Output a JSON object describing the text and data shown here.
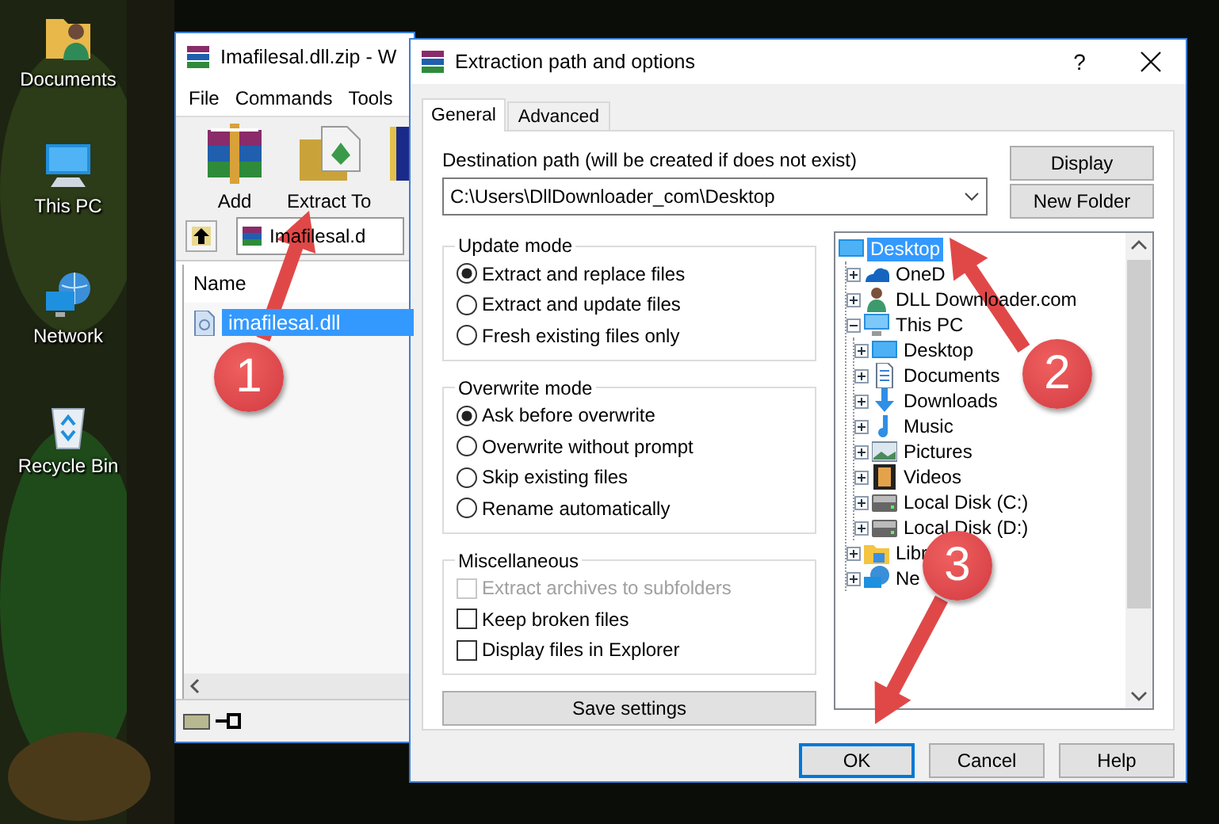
{
  "desktop": {
    "icons": [
      {
        "label": "Documents",
        "kind": "user-folder"
      },
      {
        "label": "This PC",
        "kind": "pc"
      },
      {
        "label": "Network",
        "kind": "network"
      },
      {
        "label": "Recycle Bin",
        "kind": "recycle"
      }
    ]
  },
  "archiver": {
    "title": "Imafilesal.dll.zip - W",
    "menu": [
      "File",
      "Commands",
      "Tools"
    ],
    "toolbar": [
      {
        "label": "Add",
        "kind": "add"
      },
      {
        "label": "Extract To",
        "kind": "extract"
      },
      {
        "kind": "book"
      }
    ],
    "address": "Imafilesal.d",
    "columns": [
      "Name"
    ],
    "files": [
      {
        "name": "imafilesal.dll",
        "selected": true
      }
    ]
  },
  "dialog": {
    "title": "Extraction path and options",
    "help": "?",
    "tabs": [
      {
        "label": "General",
        "selected": true
      },
      {
        "label": "Advanced",
        "selected": false
      }
    ],
    "destination": {
      "label": "Destination path (will be created if does not exist)",
      "value": "C:\\Users\\DllDownloader_com\\Desktop"
    },
    "side_buttons": [
      "Display",
      "New Folder"
    ],
    "groups": [
      {
        "title": "Update mode",
        "options": [
          {
            "kind": "radio",
            "label": "Extract and replace files",
            "selected": true
          },
          {
            "kind": "radio",
            "label": "Extract and update files",
            "selected": false
          },
          {
            "kind": "radio",
            "label": "Fresh existing files only",
            "selected": false
          }
        ]
      },
      {
        "title": "Overwrite mode",
        "options": [
          {
            "kind": "radio",
            "label": "Ask before overwrite",
            "selected": true
          },
          {
            "kind": "radio",
            "label": "Overwrite without prompt",
            "selected": false
          },
          {
            "kind": "radio",
            "label": "Skip existing files",
            "selected": false
          },
          {
            "kind": "radio",
            "label": "Rename automatically",
            "selected": false
          }
        ]
      },
      {
        "title": "Miscellaneous",
        "options": [
          {
            "kind": "checkbox",
            "label": "Extract archives to subfolders",
            "checked": false,
            "disabled": true
          },
          {
            "kind": "checkbox",
            "label": "Keep broken files",
            "checked": false,
            "disabled": false
          },
          {
            "kind": "checkbox",
            "label": "Display files in Explorer",
            "checked": false,
            "disabled": false
          }
        ]
      }
    ],
    "save_button": "Save settings",
    "tree": [
      {
        "label": "Desktop",
        "kind": "desktop",
        "selected": true,
        "children": [
          {
            "label": "OneD",
            "kind": "cloud",
            "selected": false,
            "expanded": false
          },
          {
            "label": "DLL Downloader.com",
            "kind": "user",
            "selected": false,
            "expanded": false
          },
          {
            "label": "This PC",
            "kind": "pc",
            "selected": false,
            "expanded": true,
            "children": [
              {
                "label": "Desktop",
                "kind": "desktop",
                "selected": false,
                "expanded": false
              },
              {
                "label": "Documents",
                "kind": "documents",
                "selected": false,
                "expanded": false
              },
              {
                "label": "Downloads",
                "kind": "downloads",
                "selected": false,
                "expanded": false
              },
              {
                "label": "Music",
                "kind": "music",
                "selected": false,
                "expanded": false
              },
              {
                "label": "Pictures",
                "kind": "pictures",
                "selected": false,
                "expanded": false
              },
              {
                "label": "Videos",
                "kind": "videos",
                "selected": false,
                "expanded": false
              },
              {
                "label": "Local Disk (C:)",
                "kind": "disk",
                "selected": false,
                "expanded": false
              },
              {
                "label": "Local Disk (D:)",
                "kind": "disk",
                "selected": false,
                "expanded": false
              }
            ]
          },
          {
            "label": "Libr",
            "kind": "library",
            "selected": false,
            "expanded": false
          },
          {
            "label": "Ne",
            "kind": "network",
            "selected": false,
            "expanded": false
          }
        ]
      }
    ],
    "buttons": [
      {
        "label": "OK",
        "default": true
      },
      {
        "label": "Cancel",
        "default": false
      },
      {
        "label": "Help",
        "default": false
      }
    ]
  },
  "annotations": [
    {
      "number": "1"
    },
    {
      "number": "2"
    },
    {
      "number": "3"
    }
  ]
}
